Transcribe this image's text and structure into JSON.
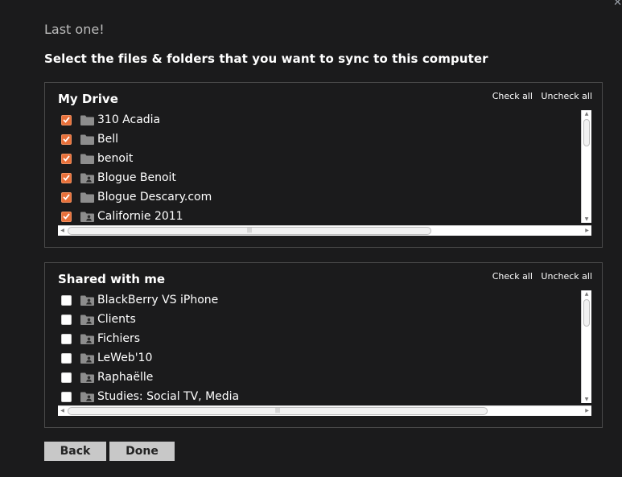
{
  "window": {
    "close_glyph": "✕"
  },
  "step_text": "Last one!",
  "heading": "Select the files & folders that you want to sync to this computer",
  "my_drive": {
    "title": "My Drive",
    "check_all": "Check all",
    "uncheck_all": "Uncheck all",
    "items": [
      {
        "label": "310 Acadia",
        "checked": true,
        "shared": false
      },
      {
        "label": "Bell",
        "checked": true,
        "shared": false
      },
      {
        "label": "benoit",
        "checked": true,
        "shared": false
      },
      {
        "label": "Blogue Benoit",
        "checked": true,
        "shared": true
      },
      {
        "label": "Blogue Descary.com",
        "checked": true,
        "shared": false
      },
      {
        "label": "Californie 2011",
        "checked": true,
        "shared": true
      }
    ]
  },
  "shared_with_me": {
    "title": "Shared with me",
    "check_all": "Check all",
    "uncheck_all": "Uncheck all",
    "items": [
      {
        "label": "BlackBerry VS iPhone",
        "checked": false,
        "shared": true
      },
      {
        "label": "Clients",
        "checked": false,
        "shared": true
      },
      {
        "label": "Fichiers",
        "checked": false,
        "shared": true
      },
      {
        "label": "LeWeb'10",
        "checked": false,
        "shared": true
      },
      {
        "label": "Raphaëlle",
        "checked": false,
        "shared": true
      },
      {
        "label": "Studies: Social TV, Media",
        "checked": false,
        "shared": true
      }
    ]
  },
  "buttons": {
    "back": "Back",
    "done": "Done"
  },
  "colors": {
    "background": "#1b1b1c",
    "checkbox_checked": "#e8703a",
    "button": "#c8c8c8"
  }
}
